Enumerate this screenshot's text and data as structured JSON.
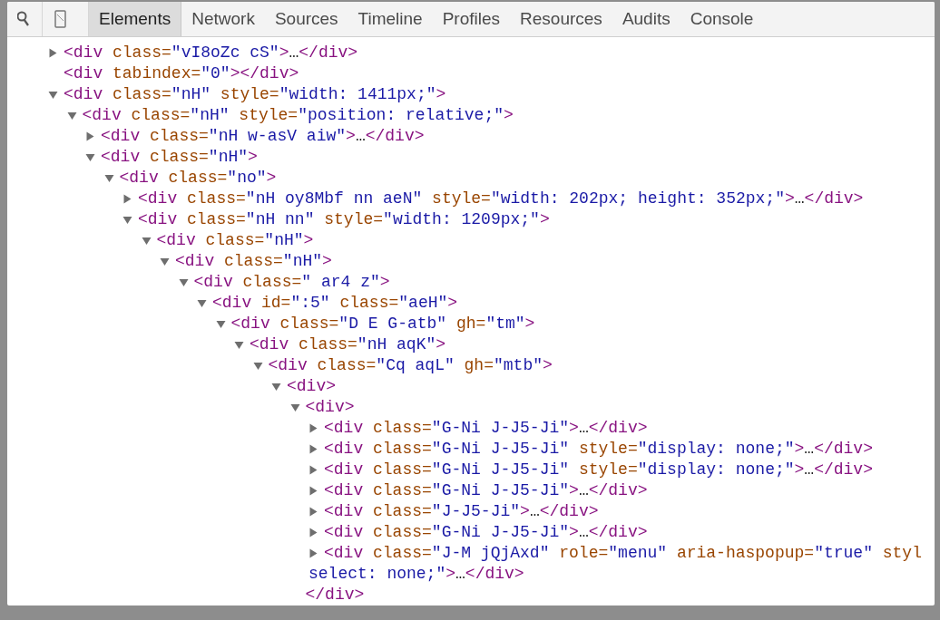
{
  "toolbar": {
    "tabs": [
      {
        "label": "Elements",
        "selected": true
      },
      {
        "label": "Network",
        "selected": false
      },
      {
        "label": "Sources",
        "selected": false
      },
      {
        "label": "Timeline",
        "selected": false
      },
      {
        "label": "Profiles",
        "selected": false
      },
      {
        "label": "Resources",
        "selected": false
      },
      {
        "label": "Audits",
        "selected": false
      },
      {
        "label": "Console",
        "selected": false
      }
    ]
  },
  "dom_tree": [
    {
      "expanded": false,
      "segments": [
        {
          "kind": "tag",
          "text": "<div"
        },
        {
          "kind": "attr",
          "text": " class="
        },
        {
          "kind": "value",
          "text": "\"vI8oZc cS\""
        },
        {
          "kind": "tag",
          "text": ">"
        },
        {
          "kind": "text",
          "text": "…"
        },
        {
          "kind": "tag",
          "text": "</div>"
        }
      ]
    },
    {
      "segments": [
        {
          "kind": "tag",
          "text": "<div"
        },
        {
          "kind": "attr",
          "text": " tabindex="
        },
        {
          "kind": "value",
          "text": "\"0\""
        },
        {
          "kind": "tag",
          "text": "></div>"
        }
      ]
    },
    {
      "expanded": true,
      "segments": [
        {
          "kind": "tag",
          "text": "<div"
        },
        {
          "kind": "attr",
          "text": " class="
        },
        {
          "kind": "value",
          "text": "\"nH\""
        },
        {
          "kind": "attr",
          "text": " style="
        },
        {
          "kind": "value",
          "text": "\"width: 1411px;\""
        },
        {
          "kind": "tag",
          "text": ">"
        }
      ],
      "children": [
        {
          "expanded": true,
          "segments": [
            {
              "kind": "tag",
              "text": "<div"
            },
            {
              "kind": "attr",
              "text": " class="
            },
            {
              "kind": "value",
              "text": "\"nH\""
            },
            {
              "kind": "attr",
              "text": " style="
            },
            {
              "kind": "value",
              "text": "\"position: relative;\""
            },
            {
              "kind": "tag",
              "text": ">"
            }
          ],
          "children": [
            {
              "expanded": false,
              "segments": [
                {
                  "kind": "tag",
                  "text": "<div"
                },
                {
                  "kind": "attr",
                  "text": " class="
                },
                {
                  "kind": "value",
                  "text": "\"nH w-asV aiw\""
                },
                {
                  "kind": "tag",
                  "text": ">"
                },
                {
                  "kind": "text",
                  "text": "…"
                },
                {
                  "kind": "tag",
                  "text": "</div>"
                }
              ]
            },
            {
              "expanded": true,
              "segments": [
                {
                  "kind": "tag",
                  "text": "<div"
                },
                {
                  "kind": "attr",
                  "text": " class="
                },
                {
                  "kind": "value",
                  "text": "\"nH\""
                },
                {
                  "kind": "tag",
                  "text": ">"
                }
              ],
              "children": [
                {
                  "expanded": true,
                  "segments": [
                    {
                      "kind": "tag",
                      "text": "<div"
                    },
                    {
                      "kind": "attr",
                      "text": " class="
                    },
                    {
                      "kind": "value",
                      "text": "\"no\""
                    },
                    {
                      "kind": "tag",
                      "text": ">"
                    }
                  ],
                  "children": [
                    {
                      "expanded": false,
                      "segments": [
                        {
                          "kind": "tag",
                          "text": "<div"
                        },
                        {
                          "kind": "attr",
                          "text": " class="
                        },
                        {
                          "kind": "value",
                          "text": "\"nH oy8Mbf nn aeN\""
                        },
                        {
                          "kind": "attr",
                          "text": " style="
                        },
                        {
                          "kind": "value",
                          "text": "\"width: 202px; height: 352px;\""
                        },
                        {
                          "kind": "tag",
                          "text": ">"
                        },
                        {
                          "kind": "text",
                          "text": "…"
                        },
                        {
                          "kind": "tag",
                          "text": "</div>"
                        }
                      ]
                    },
                    {
                      "expanded": true,
                      "segments": [
                        {
                          "kind": "tag",
                          "text": "<div"
                        },
                        {
                          "kind": "attr",
                          "text": " class="
                        },
                        {
                          "kind": "value",
                          "text": "\"nH nn\""
                        },
                        {
                          "kind": "attr",
                          "text": " style="
                        },
                        {
                          "kind": "value",
                          "text": "\"width: 1209px;\""
                        },
                        {
                          "kind": "tag",
                          "text": ">"
                        }
                      ],
                      "children": [
                        {
                          "expanded": true,
                          "segments": [
                            {
                              "kind": "tag",
                              "text": "<div"
                            },
                            {
                              "kind": "attr",
                              "text": " class="
                            },
                            {
                              "kind": "value",
                              "text": "\"nH\""
                            },
                            {
                              "kind": "tag",
                              "text": ">"
                            }
                          ],
                          "children": [
                            {
                              "expanded": true,
                              "segments": [
                                {
                                  "kind": "tag",
                                  "text": "<div"
                                },
                                {
                                  "kind": "attr",
                                  "text": " class="
                                },
                                {
                                  "kind": "value",
                                  "text": "\"nH\""
                                },
                                {
                                  "kind": "tag",
                                  "text": ">"
                                }
                              ],
                              "children": [
                                {
                                  "expanded": true,
                                  "segments": [
                                    {
                                      "kind": "tag",
                                      "text": "<div"
                                    },
                                    {
                                      "kind": "attr",
                                      "text": " class="
                                    },
                                    {
                                      "kind": "value",
                                      "text": "\" ar4 z\""
                                    },
                                    {
                                      "kind": "tag",
                                      "text": ">"
                                    }
                                  ],
                                  "children": [
                                    {
                                      "expanded": true,
                                      "segments": [
                                        {
                                          "kind": "tag",
                                          "text": "<div"
                                        },
                                        {
                                          "kind": "attr",
                                          "text": " id="
                                        },
                                        {
                                          "kind": "value",
                                          "text": "\":5\""
                                        },
                                        {
                                          "kind": "attr",
                                          "text": " class="
                                        },
                                        {
                                          "kind": "value",
                                          "text": "\"aeH\""
                                        },
                                        {
                                          "kind": "tag",
                                          "text": ">"
                                        }
                                      ],
                                      "children": [
                                        {
                                          "expanded": true,
                                          "segments": [
                                            {
                                              "kind": "tag",
                                              "text": "<div"
                                            },
                                            {
                                              "kind": "attr",
                                              "text": " class="
                                            },
                                            {
                                              "kind": "value",
                                              "text": "\"D E G-atb\""
                                            },
                                            {
                                              "kind": "attr",
                                              "text": " gh="
                                            },
                                            {
                                              "kind": "value",
                                              "text": "\"tm\""
                                            },
                                            {
                                              "kind": "tag",
                                              "text": ">"
                                            }
                                          ],
                                          "children": [
                                            {
                                              "expanded": true,
                                              "segments": [
                                                {
                                                  "kind": "tag",
                                                  "text": "<div"
                                                },
                                                {
                                                  "kind": "attr",
                                                  "text": " class="
                                                },
                                                {
                                                  "kind": "value",
                                                  "text": "\"nH aqK\""
                                                },
                                                {
                                                  "kind": "tag",
                                                  "text": ">"
                                                }
                                              ],
                                              "children": [
                                                {
                                                  "expanded": true,
                                                  "segments": [
                                                    {
                                                      "kind": "tag",
                                                      "text": "<div"
                                                    },
                                                    {
                                                      "kind": "attr",
                                                      "text": " class="
                                                    },
                                                    {
                                                      "kind": "value",
                                                      "text": "\"Cq aqL\""
                                                    },
                                                    {
                                                      "kind": "attr",
                                                      "text": " gh="
                                                    },
                                                    {
                                                      "kind": "value",
                                                      "text": "\"mtb\""
                                                    },
                                                    {
                                                      "kind": "tag",
                                                      "text": ">"
                                                    }
                                                  ],
                                                  "children": [
                                                    {
                                                      "expanded": true,
                                                      "segments": [
                                                        {
                                                          "kind": "tag",
                                                          "text": "<div>"
                                                        }
                                                      ],
                                                      "children": [
                                                        {
                                                          "expanded": true,
                                                          "segments": [
                                                            {
                                                              "kind": "tag",
                                                              "text": "<div>"
                                                            }
                                                          ],
                                                          "closing": [
                                                            {
                                                              "kind": "tag",
                                                              "text": "</div>"
                                                            }
                                                          ],
                                                          "children": [
                                                            {
                                                              "expanded": false,
                                                              "segments": [
                                                                {
                                                                  "kind": "tag",
                                                                  "text": "<div"
                                                                },
                                                                {
                                                                  "kind": "attr",
                                                                  "text": " class="
                                                                },
                                                                {
                                                                  "kind": "value",
                                                                  "text": "\"G-Ni J-J5-Ji\""
                                                                },
                                                                {
                                                                  "kind": "tag",
                                                                  "text": ">"
                                                                },
                                                                {
                                                                  "kind": "text",
                                                                  "text": "…"
                                                                },
                                                                {
                                                                  "kind": "tag",
                                                                  "text": "</div>"
                                                                }
                                                              ]
                                                            },
                                                            {
                                                              "expanded": false,
                                                              "segments": [
                                                                {
                                                                  "kind": "tag",
                                                                  "text": "<div"
                                                                },
                                                                {
                                                                  "kind": "attr",
                                                                  "text": " class="
                                                                },
                                                                {
                                                                  "kind": "value",
                                                                  "text": "\"G-Ni J-J5-Ji\""
                                                                },
                                                                {
                                                                  "kind": "attr",
                                                                  "text": " style="
                                                                },
                                                                {
                                                                  "kind": "value",
                                                                  "text": "\"display: none;\""
                                                                },
                                                                {
                                                                  "kind": "tag",
                                                                  "text": ">"
                                                                },
                                                                {
                                                                  "kind": "text",
                                                                  "text": "…"
                                                                },
                                                                {
                                                                  "kind": "tag",
                                                                  "text": "</div>"
                                                                }
                                                              ]
                                                            },
                                                            {
                                                              "expanded": false,
                                                              "segments": [
                                                                {
                                                                  "kind": "tag",
                                                                  "text": "<div"
                                                                },
                                                                {
                                                                  "kind": "attr",
                                                                  "text": " class="
                                                                },
                                                                {
                                                                  "kind": "value",
                                                                  "text": "\"G-Ni J-J5-Ji\""
                                                                },
                                                                {
                                                                  "kind": "attr",
                                                                  "text": " style="
                                                                },
                                                                {
                                                                  "kind": "value",
                                                                  "text": "\"display: none;\""
                                                                },
                                                                {
                                                                  "kind": "tag",
                                                                  "text": ">"
                                                                },
                                                                {
                                                                  "kind": "text",
                                                                  "text": "…"
                                                                },
                                                                {
                                                                  "kind": "tag",
                                                                  "text": "</div>"
                                                                }
                                                              ]
                                                            },
                                                            {
                                                              "expanded": false,
                                                              "segments": [
                                                                {
                                                                  "kind": "tag",
                                                                  "text": "<div"
                                                                },
                                                                {
                                                                  "kind": "attr",
                                                                  "text": " class="
                                                                },
                                                                {
                                                                  "kind": "value",
                                                                  "text": "\"G-Ni J-J5-Ji\""
                                                                },
                                                                {
                                                                  "kind": "tag",
                                                                  "text": ">"
                                                                },
                                                                {
                                                                  "kind": "text",
                                                                  "text": "…"
                                                                },
                                                                {
                                                                  "kind": "tag",
                                                                  "text": "</div>"
                                                                }
                                                              ]
                                                            },
                                                            {
                                                              "expanded": false,
                                                              "segments": [
                                                                {
                                                                  "kind": "tag",
                                                                  "text": "<div"
                                                                },
                                                                {
                                                                  "kind": "attr",
                                                                  "text": " class="
                                                                },
                                                                {
                                                                  "kind": "value",
                                                                  "text": "\"J-J5-Ji\""
                                                                },
                                                                {
                                                                  "kind": "tag",
                                                                  "text": ">"
                                                                },
                                                                {
                                                                  "kind": "text",
                                                                  "text": "…"
                                                                },
                                                                {
                                                                  "kind": "tag",
                                                                  "text": "</div>"
                                                                }
                                                              ]
                                                            },
                                                            {
                                                              "expanded": false,
                                                              "segments": [
                                                                {
                                                                  "kind": "tag",
                                                                  "text": "<div"
                                                                },
                                                                {
                                                                  "kind": "attr",
                                                                  "text": " class="
                                                                },
                                                                {
                                                                  "kind": "value",
                                                                  "text": "\"G-Ni J-J5-Ji\""
                                                                },
                                                                {
                                                                  "kind": "tag",
                                                                  "text": ">"
                                                                },
                                                                {
                                                                  "kind": "text",
                                                                  "text": "…"
                                                                },
                                                                {
                                                                  "kind": "tag",
                                                                  "text": "</div>"
                                                                }
                                                              ]
                                                            },
                                                            {
                                                              "expanded": false,
                                                              "segments": [
                                                                {
                                                                  "kind": "tag",
                                                                  "text": "<div"
                                                                },
                                                                {
                                                                  "kind": "attr",
                                                                  "text": " class="
                                                                },
                                                                {
                                                                  "kind": "value",
                                                                  "text": "\"J-M jQjAxd\""
                                                                },
                                                                {
                                                                  "kind": "attr",
                                                                  "text": " role="
                                                                },
                                                                {
                                                                  "kind": "value",
                                                                  "text": "\"menu\""
                                                                },
                                                                {
                                                                  "kind": "attr",
                                                                  "text": " aria-haspopup="
                                                                },
                                                                {
                                                                  "kind": "value",
                                                                  "text": "\"true\""
                                                                },
                                                                {
                                                                  "kind": "attr",
                                                                  "text": " styl"
                                                                }
                                                              ],
                                                              "wrapped": [
                                                                {
                                                                  "kind": "value",
                                                                  "text": "select: none;\""
                                                                },
                                                                {
                                                                  "kind": "tag",
                                                                  "text": ">"
                                                                },
                                                                {
                                                                  "kind": "text",
                                                                  "text": "…"
                                                                },
                                                                {
                                                                  "kind": "tag",
                                                                  "text": "</div>"
                                                                }
                                                              ]
                                                            }
                                                          ]
                                                        }
                                                      ]
                                                    }
                                                  ]
                                                }
                                              ]
                                            }
                                          ]
                                        }
                                      ]
                                    }
                                  ]
                                }
                              ]
                            }
                          ]
                        }
                      ]
                    }
                  ]
                }
              ]
            }
          ]
        }
      ]
    }
  ]
}
